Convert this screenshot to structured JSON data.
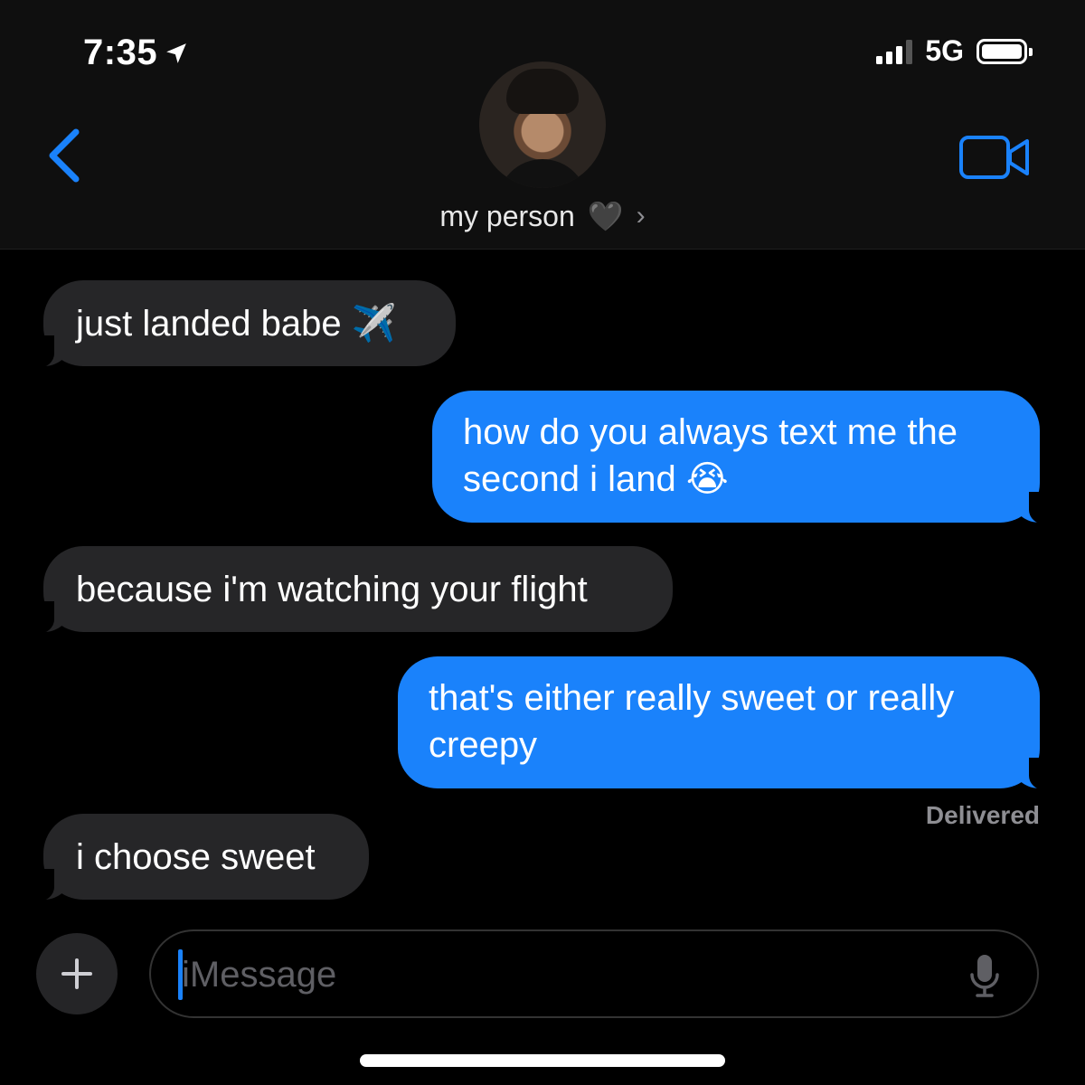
{
  "status_bar": {
    "time": "7:35",
    "network": "5G"
  },
  "header": {
    "contact_name": "my person",
    "contact_emoji": "🖤",
    "chevron": "›"
  },
  "messages": [
    {
      "direction": "incoming",
      "text": "just landed babe ✈️"
    },
    {
      "direction": "outgoing",
      "text": "how do you always text me the second i land 😭"
    },
    {
      "direction": "incoming",
      "text": "because i'm watching your flight"
    },
    {
      "direction": "outgoing",
      "text": "that's either really sweet or really creepy"
    },
    {
      "direction": "incoming",
      "text": "i choose sweet"
    }
  ],
  "delivery_status": "Delivered",
  "composer": {
    "placeholder": "iMessage"
  },
  "colors": {
    "accent": "#1a82fb",
    "incoming_bubble": "#262628",
    "background": "#000000"
  },
  "icons": [
    "location-arrow-icon",
    "signal-icon",
    "battery-icon",
    "back-chevron-icon",
    "video-camera-icon",
    "plus-icon",
    "microphone-icon"
  ]
}
